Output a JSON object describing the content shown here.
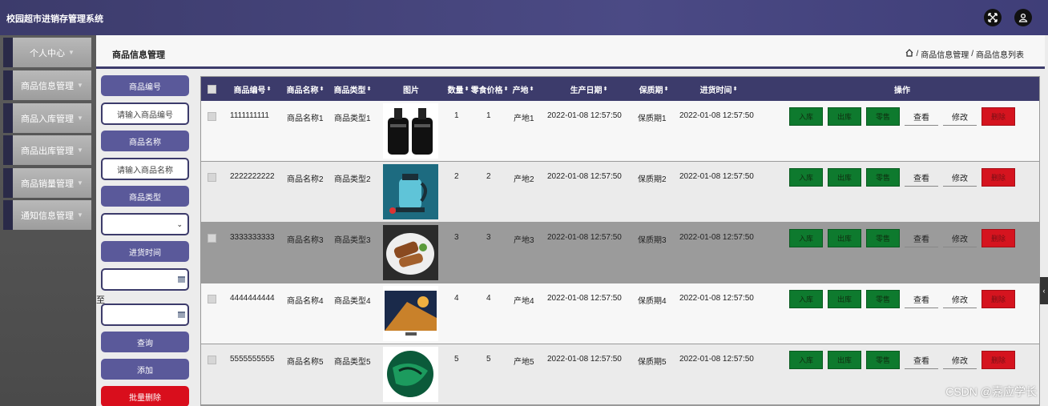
{
  "header": {
    "app_title": "校园超市进销存管理系统",
    "expand_icon": "expand-icon",
    "user_icon": "user-icon"
  },
  "sidebar": {
    "items": [
      {
        "label": "个人中心"
      },
      {
        "label": "商品信息管理"
      },
      {
        "label": "商品入库管理"
      },
      {
        "label": "商品出库管理"
      },
      {
        "label": "商品销量管理"
      },
      {
        "label": "通知信息管理"
      }
    ]
  },
  "page": {
    "title": "商品信息管理",
    "breadcrumb": {
      "home_icon": "home-icon",
      "sep": "/",
      "level1": "商品信息管理",
      "level2": "商品信息列表"
    }
  },
  "filters": {
    "code_label": "商品编号",
    "code_placeholder": "请输入商品编号",
    "name_label": "商品名称",
    "name_placeholder": "请输入商品名称",
    "type_label": "商品类型",
    "type_value": "",
    "time_label": "进货时间",
    "to_label": "至",
    "query": "查询",
    "add": "添加",
    "batch_delete": "批量删除"
  },
  "table": {
    "headers": {
      "code": "商品编号",
      "name": "商品名称",
      "type": "商品类型",
      "image": "图片",
      "qty": "数量",
      "price": "零食价格",
      "origin": "产地",
      "prod_date": "生产日期",
      "shelf": "保质期",
      "in_time": "进货时间",
      "ops": "操作"
    },
    "sort_glyph": "⬍",
    "ops": {
      "in": "入库",
      "out": "出库",
      "retail": "零售",
      "view": "查看",
      "edit": "修改",
      "delete": "删除"
    },
    "rows": [
      {
        "code": "1111111111",
        "name": "商品名称1",
        "type": "商品类型1",
        "image": "black-bottles-photo",
        "qty": "1",
        "price": "1",
        "origin": "产地1",
        "prod_date": "2022-01-08 12:57:50",
        "shelf": "保质期1",
        "in_time": "2022-01-08 12:57:50"
      },
      {
        "code": "2222222222",
        "name": "商品名称2",
        "type": "商品类型2",
        "image": "blue-kettle-photo",
        "qty": "2",
        "price": "2",
        "origin": "产地2",
        "prod_date": "2022-01-08 12:57:50",
        "shelf": "保质期2",
        "in_time": "2022-01-08 12:57:50"
      },
      {
        "code": "3333333333",
        "name": "商品名称3",
        "type": "商品类型3",
        "image": "food-plate-photo",
        "qty": "3",
        "price": "3",
        "origin": "产地3",
        "prod_date": "2022-01-08 12:57:50",
        "shelf": "保质期3",
        "in_time": "2022-01-08 12:57:50"
      },
      {
        "code": "4444444444",
        "name": "商品名称4",
        "type": "商品类型4",
        "image": "tv-screen-photo",
        "qty": "4",
        "price": "4",
        "origin": "产地4",
        "prod_date": "2022-01-08 12:57:50",
        "shelf": "保质期4",
        "in_time": "2022-01-08 12:57:50"
      },
      {
        "code": "5555555555",
        "name": "商品名称5",
        "type": "商品类型5",
        "image": "green-ball-photo",
        "qty": "5",
        "price": "5",
        "origin": "产地5",
        "prod_date": "2022-01-08 12:57:50",
        "shelf": "保质期5",
        "in_time": "2022-01-08 12:57:50"
      }
    ]
  },
  "watermark": "CSDN @嘉应学长",
  "colors": {
    "primary": "#3c3b6b",
    "button": "#5a599a",
    "green": "#0e7a2e",
    "red": "#d5141f"
  }
}
